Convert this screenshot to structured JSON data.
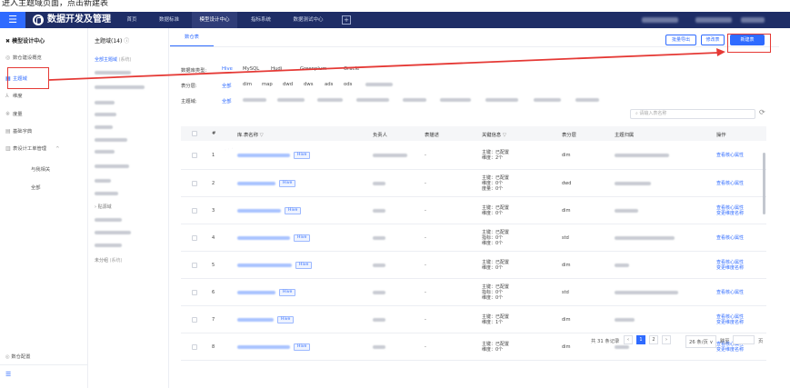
{
  "caption": "进入主题域页面，点击新建表",
  "topbar": {
    "app_title": "数据开发及管理",
    "nav": [
      "首页",
      "数据标准",
      "模型设计中心",
      "指标系统",
      "数据测试中心"
    ],
    "active_nav": "模型设计中心",
    "plus": "+"
  },
  "sidebar": {
    "header": "模型设计中心",
    "items": [
      {
        "label": "数仓建设概览",
        "icon": "dashboard-icon"
      },
      {
        "label": "主题域",
        "icon": "grid-icon",
        "active": true
      },
      {
        "label": "维度",
        "icon": "dimension-icon"
      },
      {
        "label": "度量",
        "icon": "measure-icon"
      },
      {
        "label": "基础字典",
        "icon": "dictionary-icon"
      },
      {
        "label": "表设计工单管理",
        "icon": "workorder-icon",
        "expanded": true
      }
    ],
    "sub_items": [
      "与我相关",
      "全部"
    ],
    "bottom": "数仓配置",
    "expand_caret": "^"
  },
  "panel2": {
    "header": "主题域(14)",
    "first_item": "全部主题域",
    "first_item_note": "(系统)",
    "group_label": "› 贴源域",
    "uncat_label": "未分组",
    "uncat_note": "(系统)"
  },
  "main": {
    "tab": "数仓表",
    "buttons": {
      "batch_export": "批量导出",
      "modify_table": "修改表",
      "new_table": "新建表"
    },
    "filters": {
      "db_type_label": "数据库类型:",
      "db_types": [
        "Hive",
        "MySQL",
        "Hudi",
        "Greenplum",
        "Oracle"
      ],
      "layer_label": "表分层:",
      "layers": [
        "全部",
        "dim",
        "map",
        "dwd",
        "dws",
        "ads",
        "ods"
      ],
      "domain_label": "主题域:",
      "domain_all": "全部"
    },
    "search_placeholder": "请输入表名称",
    "refresh_icon": "⟳"
  },
  "table": {
    "columns": [
      "#",
      "库.表名称",
      "负责人",
      "表描述",
      "关键信息",
      "表分层",
      "主题归属",
      "操作"
    ],
    "rows": [
      {
        "no": "1",
        "tag": "Hive",
        "desc": "-",
        "key_info": [
          "主键：已配置",
          "维度：2个"
        ],
        "layer": "dim",
        "ops": [
          "查看核心属性"
        ]
      },
      {
        "no": "2",
        "tag": "Hive",
        "desc": "-",
        "key_info": [
          "主键：已配置",
          "维度：0个",
          "度量：0个"
        ],
        "layer": "dwd",
        "ops": [
          "查看核心属性"
        ]
      },
      {
        "no": "3",
        "tag": "Hive",
        "desc": "-",
        "key_info": [
          "主键：已配置",
          "维度：0个"
        ],
        "layer": "dim",
        "ops": [
          "查看核心属性",
          "变更维度名称"
        ]
      },
      {
        "no": "4",
        "tag": "Hive",
        "desc": "-",
        "key_info": [
          "主键：已配置",
          "指标：0个",
          "维度：0个"
        ],
        "layer": "std",
        "ops": [
          "查看核心属性"
        ]
      },
      {
        "no": "5",
        "tag": "Hive",
        "desc": "-",
        "key_info": [
          "主键：已配置",
          "维度：0个"
        ],
        "layer": "dim",
        "ops": [
          "查看核心属性",
          "变更维度名称"
        ]
      },
      {
        "no": "6",
        "tag": "Hive",
        "desc": "-",
        "key_info": [
          "主键：已配置",
          "指标：0个",
          "维度：0个"
        ],
        "layer": "std",
        "ops": [
          "查看核心属性"
        ]
      },
      {
        "no": "7",
        "tag": "Hive",
        "desc": "-",
        "key_info": [
          "主键：已配置",
          "维度：1个"
        ],
        "layer": "dim",
        "ops": [
          "查看核心属性",
          "变更维度名称"
        ]
      },
      {
        "no": "8",
        "tag": "Hive",
        "desc": "-",
        "key_info": [
          "主键：已配置",
          "维度：0个"
        ],
        "layer": "dim",
        "ops": [
          "查看核心属性",
          "变更维度名称"
        ]
      }
    ]
  },
  "pagination": {
    "total": "共 31 条记录",
    "pages": [
      "1",
      "2"
    ],
    "page_size": "26 条/页",
    "goto": "跳至",
    "page_unit": "页"
  },
  "colors": {
    "accent": "#2f6bff",
    "topbar": "#1e2d66",
    "highlight": "#e53935"
  }
}
